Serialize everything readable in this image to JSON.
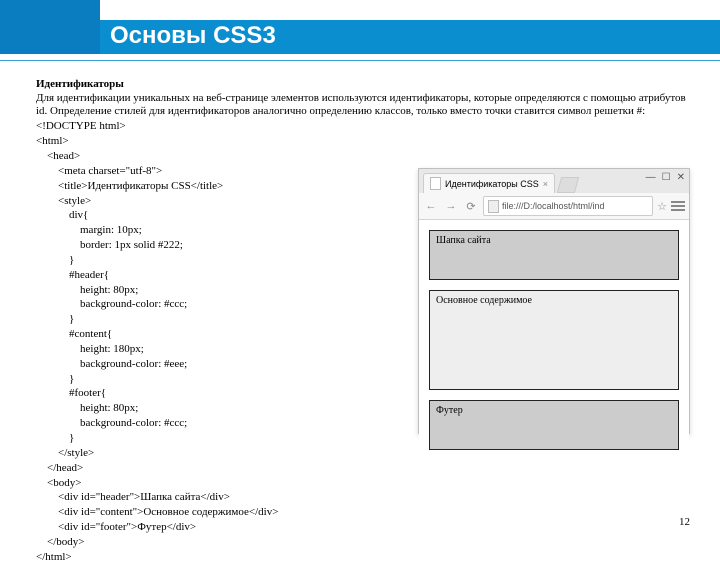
{
  "header": {
    "title": "Основы CSS3"
  },
  "text": {
    "heading": "Идентификаторы",
    "paragraph": "Для идентификации уникальных на веб-странице элементов используются идентификаторы, которые определяются с помощью атрибутов id. Определение стилей для идентификаторов аналогично определению классов, только вместо точки ставится символ решетки #:"
  },
  "code": {
    "lines": "<!DOCTYPE html>\n<html>\n    <head>\n        <meta charset=\"utf-8\">\n        <title>Идентификаторы CSS</title>\n        <style>\n            div{\n                margin: 10px;\n                border: 1px solid #222;\n            }\n            #header{\n                height: 80px;\n                background-color: #ccc;\n            }\n            #content{\n                height: 180px;\n                background-color: #eee;\n            }\n            #footer{\n                height: 80px;\n                background-color: #ccc;\n            }\n        </style>\n    </head>\n    <body>\n        <div id=\"header\">Шапка сайта</div>\n        <div id=\"content\">Основное содержимое</div>\n        <div id=\"footer\">Футер</div>\n    </body>\n</html>"
  },
  "browser": {
    "tab_title": "Идентификаторы CSS",
    "address": "file:///D:/localhost/html/ind",
    "win_min": "—",
    "win_max": "☐",
    "win_close": "✕",
    "nav_back": "←",
    "nav_fwd": "→",
    "nav_reload": "⟳",
    "star": "☆",
    "preview": {
      "header_text": "Шапка сайта",
      "content_text": "Основное содержимое",
      "footer_text": "Футер"
    }
  },
  "page_number": "12"
}
